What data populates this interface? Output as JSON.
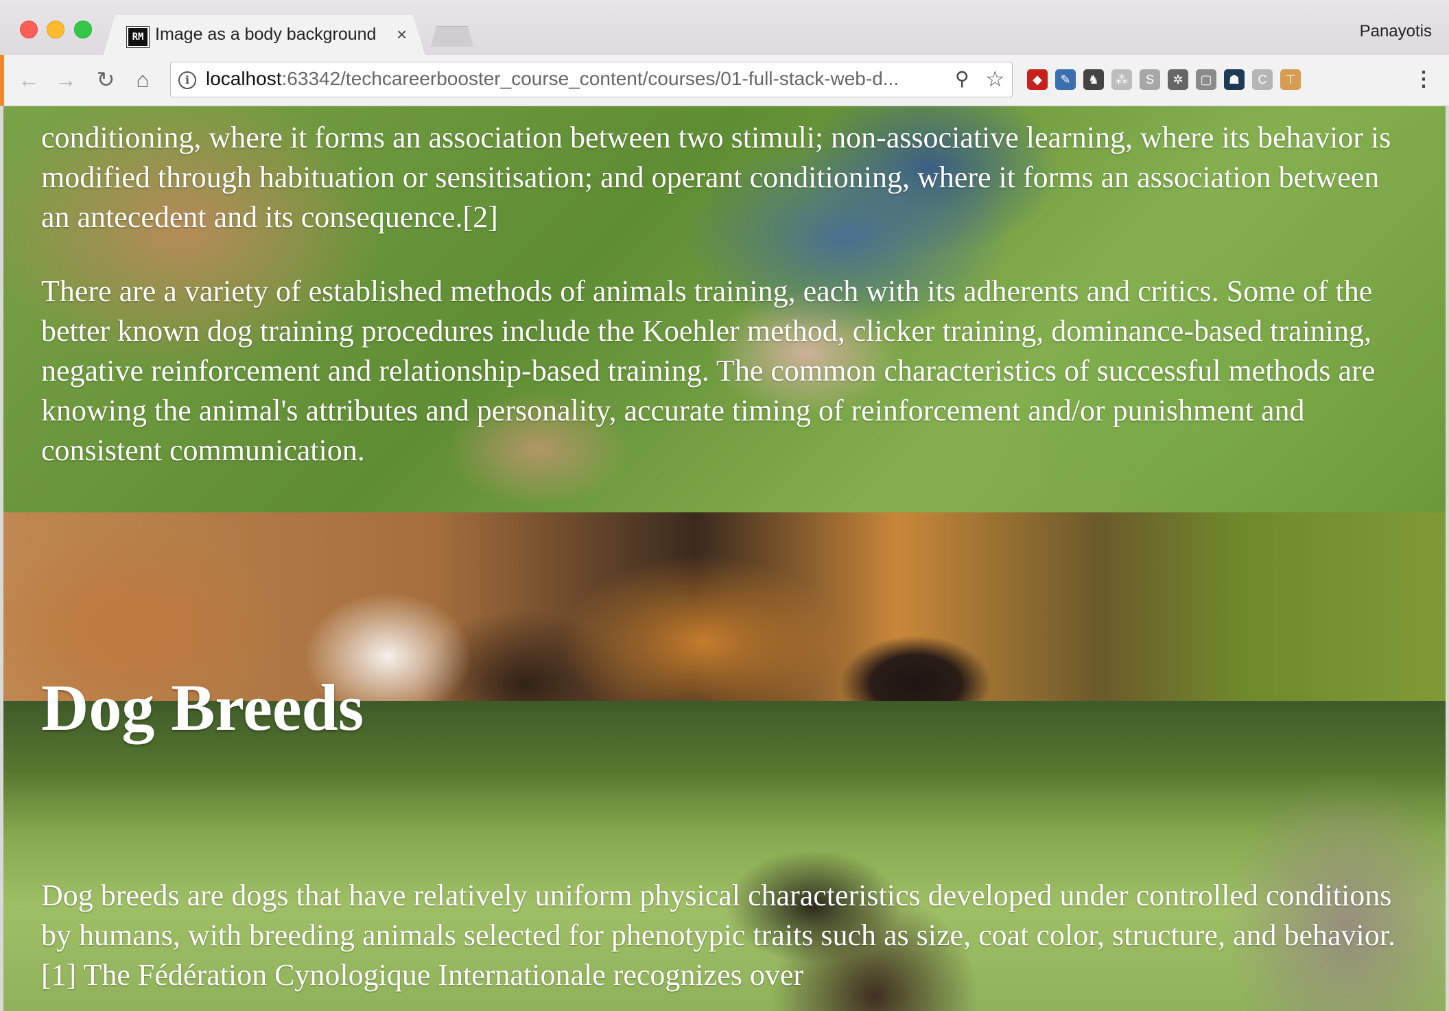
{
  "browser": {
    "tab": {
      "favicon_text": "RM",
      "title": "Image as a body background",
      "close_glyph": "×"
    },
    "profile_name": "Panayotis",
    "address_bar": {
      "host": "localhost",
      "rest": ":63342/techcareerbooster_course_content/courses/01-full-stack-web-d...",
      "info_glyph": "i"
    },
    "nav": {
      "back_glyph": "←",
      "forward_glyph": "→",
      "reload_glyph": "↻",
      "home_glyph": "⌂",
      "zoom_glyph": "⚲",
      "star_glyph": "☆",
      "menu_glyph": "⋮"
    },
    "extensions": [
      {
        "icon": "ruby-icon",
        "glyph": "◆",
        "color": "#c8201c"
      },
      {
        "icon": "eyedropper-icon",
        "glyph": "✎",
        "color": "#3a6fb0"
      },
      {
        "icon": "evernote-icon",
        "glyph": "♞",
        "color": "#444444"
      },
      {
        "icon": "network-icon",
        "glyph": "⁂",
        "color": "#bdbdbd"
      },
      {
        "icon": "skype-icon",
        "glyph": "S",
        "color": "#a7a7a7"
      },
      {
        "icon": "settings-wheel-icon",
        "glyph": "✲",
        "color": "#666666"
      },
      {
        "icon": "rounded-square-icon",
        "glyph": "▢",
        "color": "#8a8a8a"
      },
      {
        "icon": "ghost-icon",
        "glyph": "☗",
        "color": "#1d3b57"
      },
      {
        "icon": "letter-c-icon",
        "glyph": "C",
        "color": "#b5b5b5"
      },
      {
        "icon": "hammer-icon",
        "glyph": "⊤",
        "color": "#d59c52"
      }
    ]
  },
  "page": {
    "paragraph_top": "conditioning, where it forms an association between two stimuli; non-associative learning, where its behavior is modified through habituation or sensitisation; and operant conditioning, where it forms an association between an antecedent and its consequence.[2]",
    "paragraph_methods": "There are a variety of established methods of animals training, each with its adherents and critics. Some of the better known dog training procedures include the Koehler method, clicker training, dominance-based training, negative reinforcement and relationship-based training. The common characteristics of successful methods are knowing the animal's attributes and personality, accurate timing of reinforcement and/or punishment and consistent communication.",
    "heading_breeds": "Dog Breeds",
    "paragraph_breeds": "Dog breeds are dogs that have relatively uniform physical characteristics developed under controlled conditions by humans, with breeding animals selected for phenotypic traits such as size, coat color, structure, and behavior.[1] The Fédération Cynologique Internationale recognizes over"
  },
  "colors": {
    "close_red": "#fc5f57",
    "minimize_yellow": "#fdbc2e",
    "zoom_green": "#33c748"
  }
}
